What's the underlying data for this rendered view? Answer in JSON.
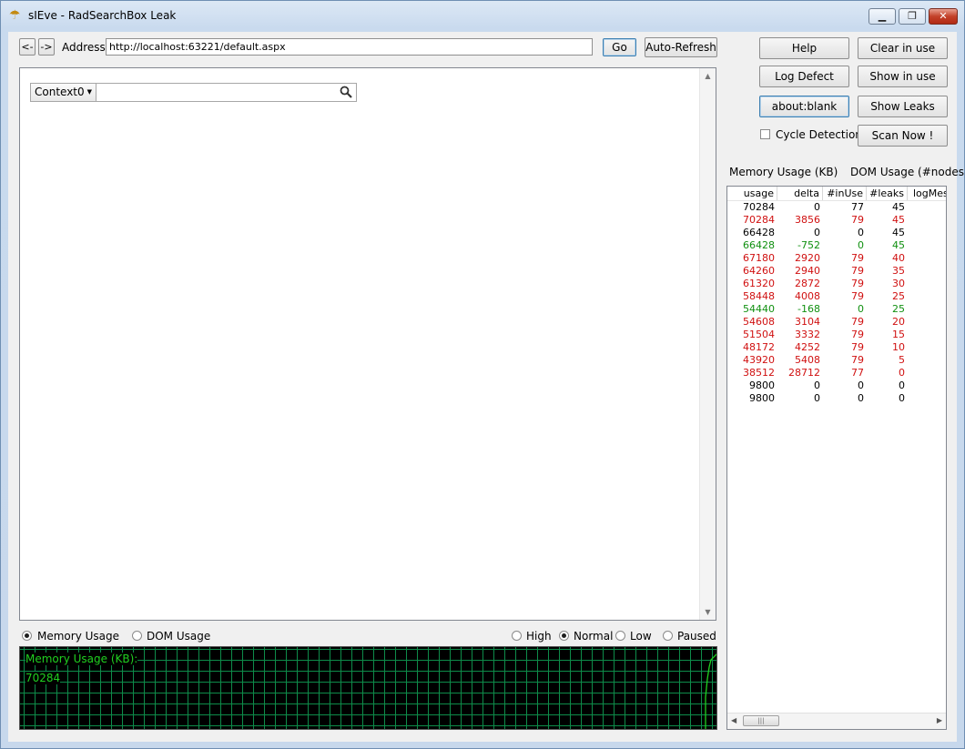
{
  "window": {
    "title": "sIEve - RadSearchBox Leak",
    "minimize": "▁",
    "restore": "❐",
    "close": "✕"
  },
  "toolbar": {
    "back_label": "<-",
    "forward_label": "->",
    "address_label": "Address:",
    "address_value": "http://localhost:63221/default.aspx",
    "go_label": "Go",
    "autorefresh_label": "Auto-Refresh"
  },
  "side_buttons": {
    "help": "Help",
    "clear_in_use": "Clear in use",
    "log_defect": "Log Defect",
    "show_in_use": "Show in use",
    "about_blank": "about:blank",
    "show_leaks": "Show Leaks",
    "cycle_detection": "Cycle Detection",
    "scan_now": "Scan Now !"
  },
  "usage_labels": {
    "memory": "Memory Usage (KB)",
    "dom": "DOM Usage (#nodes)"
  },
  "searchbox": {
    "context": "Context0",
    "query": ""
  },
  "graph_options": {
    "memory": "Memory Usage",
    "dom": "DOM Usage",
    "high": "High",
    "normal": "Normal",
    "low": "Low",
    "paused": "Paused",
    "selected_type": "memory",
    "selected_speed": "normal"
  },
  "graph": {
    "title": "Memory Usage (KB):",
    "value": "70284",
    "line_color": "#20d020"
  },
  "colors": {
    "red": "#d01010",
    "green": "#109010",
    "black": "#000000"
  },
  "table": {
    "columns": [
      "usage",
      "delta",
      "#inUse",
      "#leaks",
      "logMes"
    ],
    "rows": [
      {
        "usage": "70284",
        "delta": "0",
        "inUse": "77",
        "leaks": "45",
        "color": "black"
      },
      {
        "usage": "70284",
        "delta": "3856",
        "inUse": "79",
        "leaks": "45",
        "color": "red"
      },
      {
        "usage": "66428",
        "delta": "0",
        "inUse": "0",
        "leaks": "45",
        "color": "black"
      },
      {
        "usage": "66428",
        "delta": "-752",
        "inUse": "0",
        "leaks": "45",
        "color": "green"
      },
      {
        "usage": "67180",
        "delta": "2920",
        "inUse": "79",
        "leaks": "40",
        "color": "red"
      },
      {
        "usage": "64260",
        "delta": "2940",
        "inUse": "79",
        "leaks": "35",
        "color": "red"
      },
      {
        "usage": "61320",
        "delta": "2872",
        "inUse": "79",
        "leaks": "30",
        "color": "red"
      },
      {
        "usage": "58448",
        "delta": "4008",
        "inUse": "79",
        "leaks": "25",
        "color": "red"
      },
      {
        "usage": "54440",
        "delta": "-168",
        "inUse": "0",
        "leaks": "25",
        "color": "green"
      },
      {
        "usage": "54608",
        "delta": "3104",
        "inUse": "79",
        "leaks": "20",
        "color": "red"
      },
      {
        "usage": "51504",
        "delta": "3332",
        "inUse": "79",
        "leaks": "15",
        "color": "red"
      },
      {
        "usage": "48172",
        "delta": "4252",
        "inUse": "79",
        "leaks": "10",
        "color": "red"
      },
      {
        "usage": "43920",
        "delta": "5408",
        "inUse": "79",
        "leaks": "5",
        "color": "red"
      },
      {
        "usage": "38512",
        "delta": "28712",
        "inUse": "77",
        "leaks": "0",
        "color": "red"
      },
      {
        "usage": "9800",
        "delta": "0",
        "inUse": "0",
        "leaks": "0",
        "color": "black"
      },
      {
        "usage": "9800",
        "delta": "0",
        "inUse": "0",
        "leaks": "0",
        "color": "black"
      }
    ]
  }
}
